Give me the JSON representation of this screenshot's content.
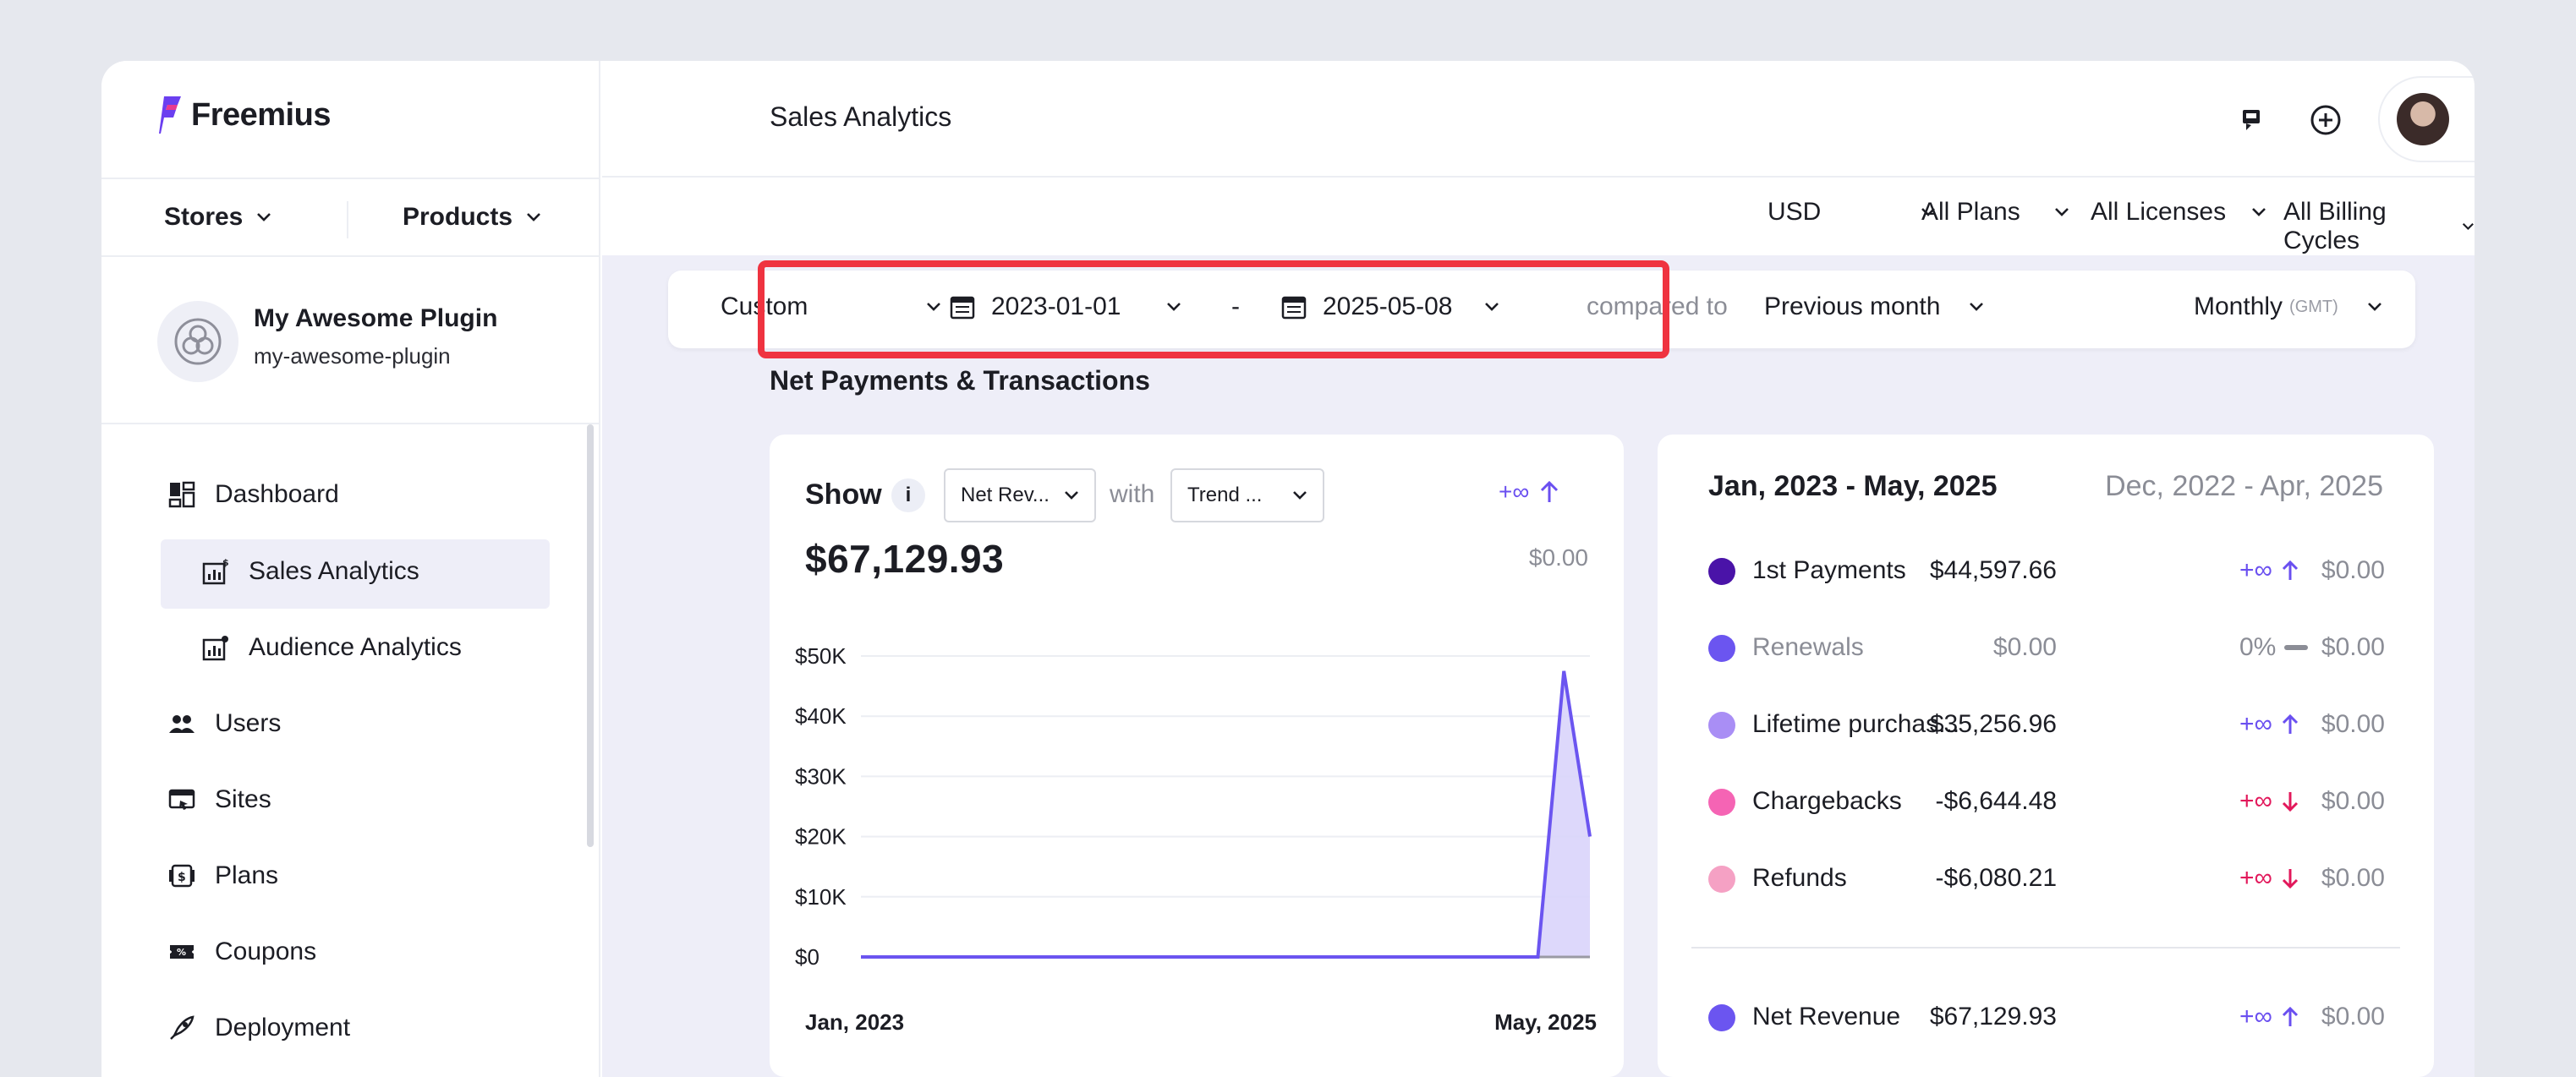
{
  "brand": {
    "name": "Freemius"
  },
  "store_row": {
    "stores": "Stores",
    "products": "Products"
  },
  "plugin": {
    "name": "My Awesome Plugin",
    "slug": "my-awesome-plugin"
  },
  "sidebar": {
    "items": [
      {
        "label": "Dashboard",
        "icon": "dashboard-icon"
      },
      {
        "label": "Sales Analytics",
        "icon": "sales-analytics-icon",
        "active": true
      },
      {
        "label": "Audience Analytics",
        "icon": "audience-analytics-icon"
      },
      {
        "label": "Users",
        "icon": "users-icon"
      },
      {
        "label": "Sites",
        "icon": "sites-icon"
      },
      {
        "label": "Plans",
        "icon": "plans-icon"
      },
      {
        "label": "Coupons",
        "icon": "coupons-icon"
      },
      {
        "label": "Deployment",
        "icon": "deployment-icon"
      }
    ]
  },
  "header": {
    "title": "Sales Analytics"
  },
  "filters": {
    "currency": "USD",
    "plans": "All Plans",
    "licenses": "All Licenses",
    "billing": "All Billing Cycles"
  },
  "range": {
    "preset": "Custom",
    "start": "2023-01-01",
    "separator": "-",
    "end": "2025-05-08",
    "compared_label": "compared to",
    "compared_value": "Previous month",
    "interval": "Monthly",
    "timezone": "(GMT)"
  },
  "section_title": "Net Payments & Transactions",
  "left_card": {
    "show_label": "Show",
    "info": "i",
    "metric_select": "Net Rev...",
    "with_label": "with",
    "trend_select": "Trend ...",
    "trend_change": "+∞",
    "value": "$67,129.93",
    "compare_value": "$0.00"
  },
  "chart_data": {
    "type": "area",
    "x_labels": [
      "Jan, 2023",
      "May, 2025"
    ],
    "y_ticks": [
      "$0",
      "$10K",
      "$20K",
      "$30K",
      "$40K",
      "$50K"
    ],
    "ylim": [
      0,
      50000
    ],
    "series": [
      {
        "values": [
          0,
          0,
          0,
          0,
          0,
          0,
          0,
          0,
          0,
          0,
          0,
          0,
          0,
          0,
          0,
          0,
          0,
          0,
          0,
          0,
          0,
          0,
          0,
          0,
          0,
          0,
          0,
          47500,
          20000
        ]
      }
    ],
    "colors": {
      "line": "#6b55f0",
      "fill": "#d9d4fb",
      "baseline": "#9a9aa4"
    }
  },
  "right_card": {
    "range": "Jan, 2023 - May, 2025",
    "compare_range": "Dec, 2022 - Apr, 2025",
    "rows": [
      {
        "label": "1st Payments",
        "amount": "$44,597.66",
        "change": "+∞",
        "dir": "up",
        "prev": "$0.00",
        "color": "#4a13a8"
      },
      {
        "label": "Renewals",
        "amount": "$0.00",
        "change": "0%",
        "dir": "flat",
        "prev": "$0.00",
        "color": "#6b55f0",
        "muted": true
      },
      {
        "label": "Lifetime purchas...",
        "amount": "$35,256.96",
        "change": "+∞",
        "dir": "up",
        "prev": "$0.00",
        "color": "#a98ef5"
      },
      {
        "label": "Chargebacks",
        "amount": "-$6,644.48",
        "change": "+∞",
        "dir": "down",
        "prev": "$0.00",
        "color": "#f564b4"
      },
      {
        "label": "Refunds",
        "amount": "-$6,080.21",
        "change": "+∞",
        "dir": "down",
        "prev": "$0.00",
        "color": "#f5a1c4"
      }
    ],
    "total": {
      "label": "Net Revenue",
      "amount": "$67,129.93",
      "change": "+∞",
      "dir": "up",
      "prev": "$0.00",
      "color": "#6b55f0"
    }
  }
}
